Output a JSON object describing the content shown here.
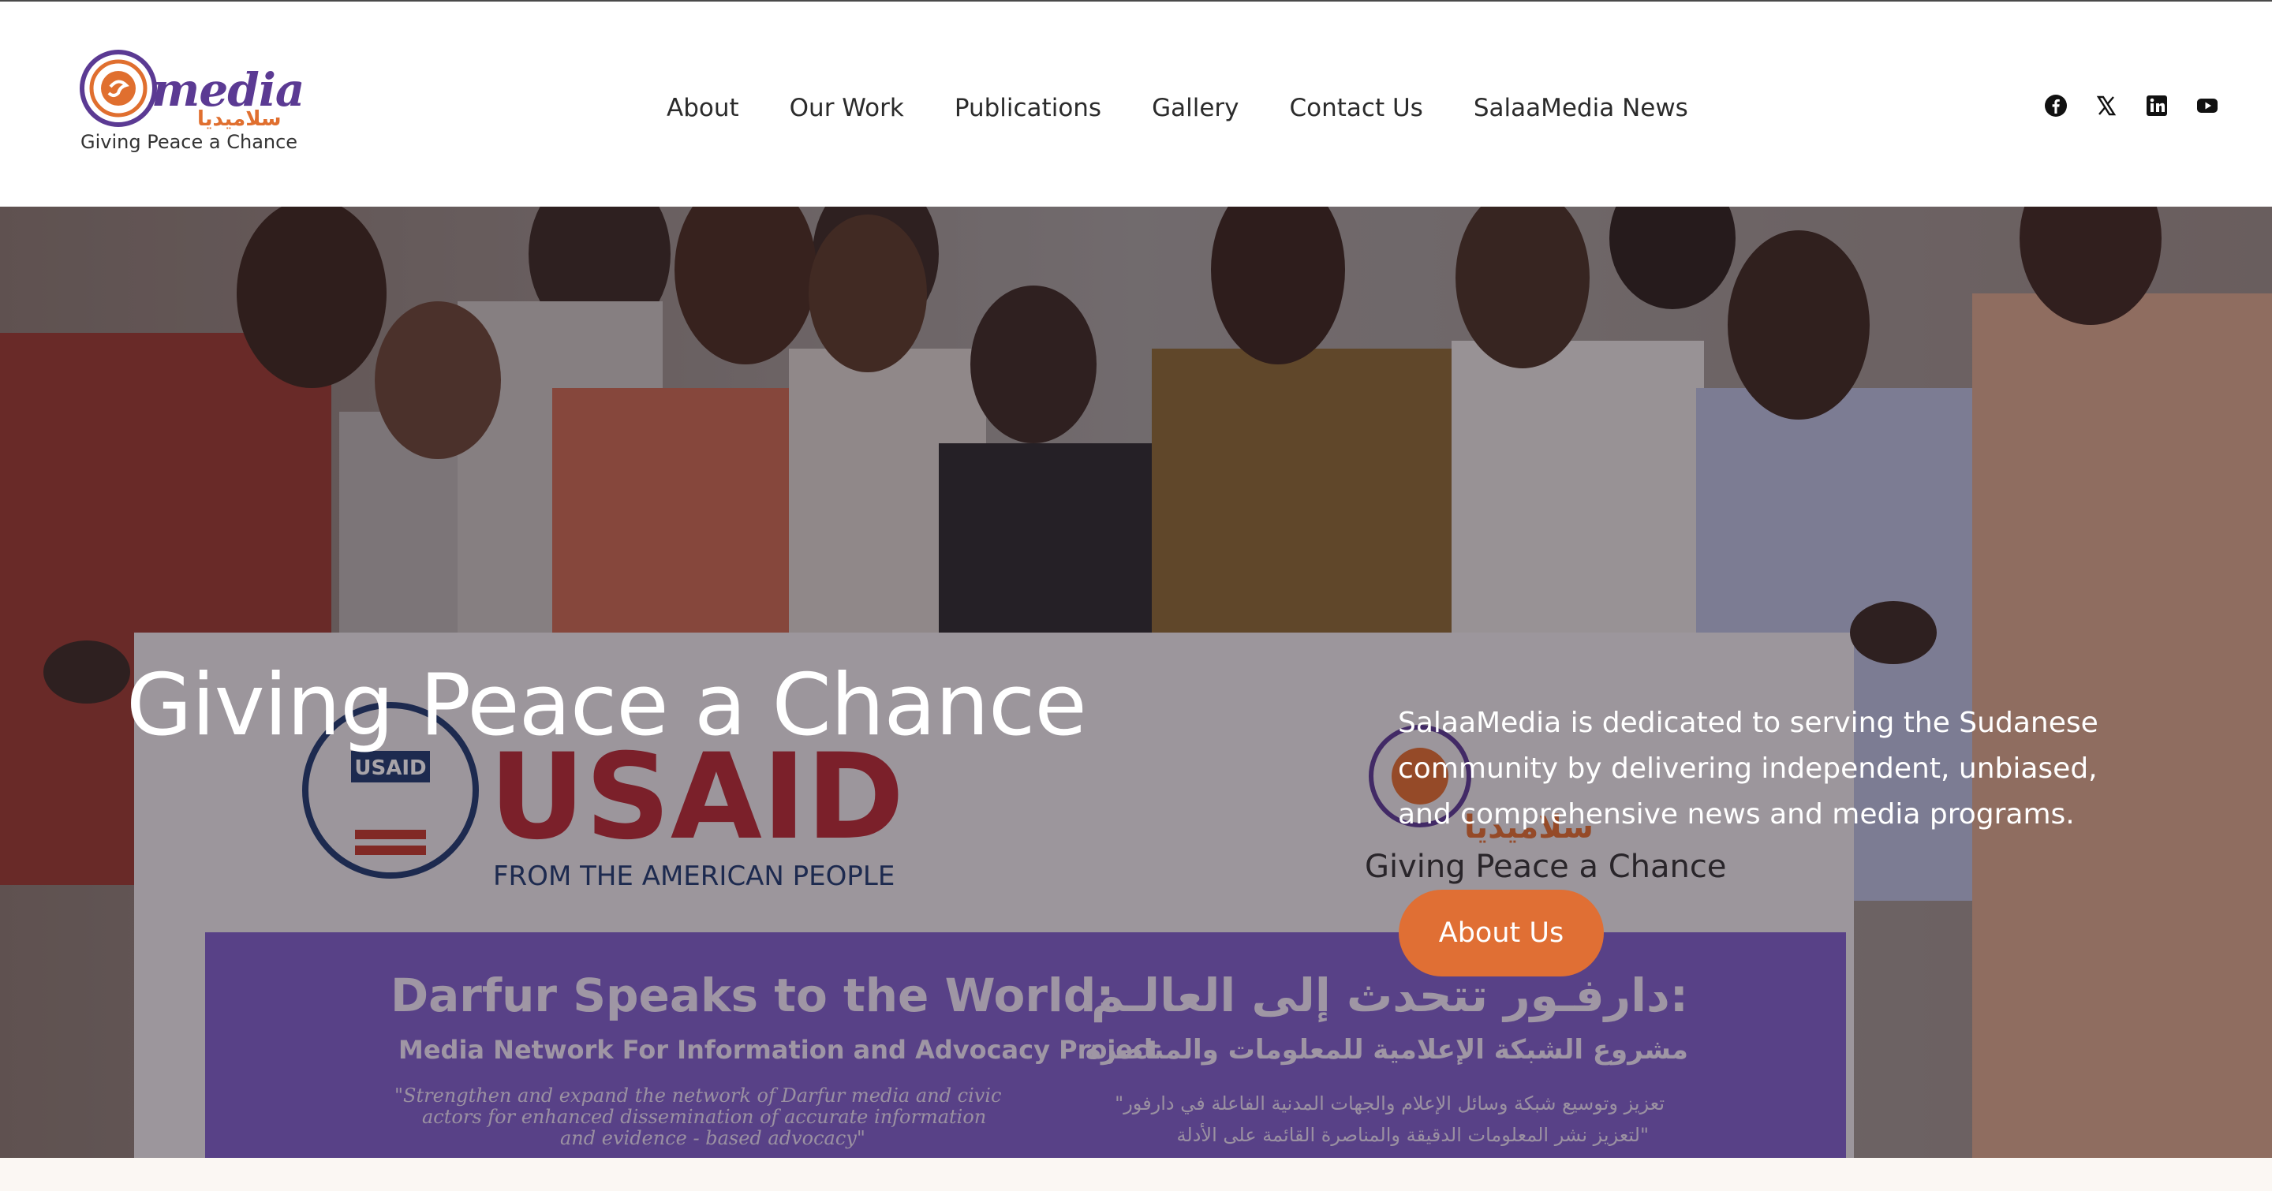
{
  "logo": {
    "word": "media",
    "arabic": "سلاميديا",
    "tagline": "Giving Peace a Chance"
  },
  "nav": {
    "items": [
      {
        "label": "About"
      },
      {
        "label": "Our Work"
      },
      {
        "label": "Publications"
      },
      {
        "label": "Gallery"
      },
      {
        "label": "Contact Us"
      },
      {
        "label": "SalaaMedia News"
      }
    ]
  },
  "social": {
    "icons": [
      "facebook-icon",
      "x-twitter-icon",
      "linkedin-icon",
      "youtube-icon"
    ]
  },
  "hero": {
    "title": "Giving Peace a Chance",
    "description": "SalaaMedia is dedicated to serving the Sudanese community by delivering independent, unbiased, and comprehensive news and media programs.",
    "button_label": "About Us",
    "banner": {
      "org": "USAID",
      "org_sub": "FROM THE AMERICAN PEOPLE",
      "seal_text": "USAID",
      "logo_tagline": "Giving Peace a Chance",
      "logo_arabic": "سلاميديا",
      "title_en": "Darfur Speaks to the World:",
      "title_ar": "دارفـور تتحدث إلى العالـم:",
      "subtitle_en": "Media Network For Information and Advocacy Project",
      "subtitle_ar": "مشروع الشبكة الإعلامية للمعلومات والمناصرة",
      "quote_en_1": "\"Strengthen and expand the network of Darfur media and civic",
      "quote_en_2": "actors for enhanced dissemination of accurate information",
      "quote_en_3": "and evidence - based advocacy\"",
      "quote_ar_1": "\"تعزيز وتوسيع شبكة وسائل الإعلام والجهات المدنية الفاعلة في دارفور",
      "quote_ar_2": "لتعزيز نشر المعلومات الدقيقة والمناصرة القائمة على الأدلة\""
    }
  },
  "colors": {
    "accent": "#e06f34",
    "brand_purple": "#5b3a93",
    "nav_text": "#2b2b2b"
  }
}
